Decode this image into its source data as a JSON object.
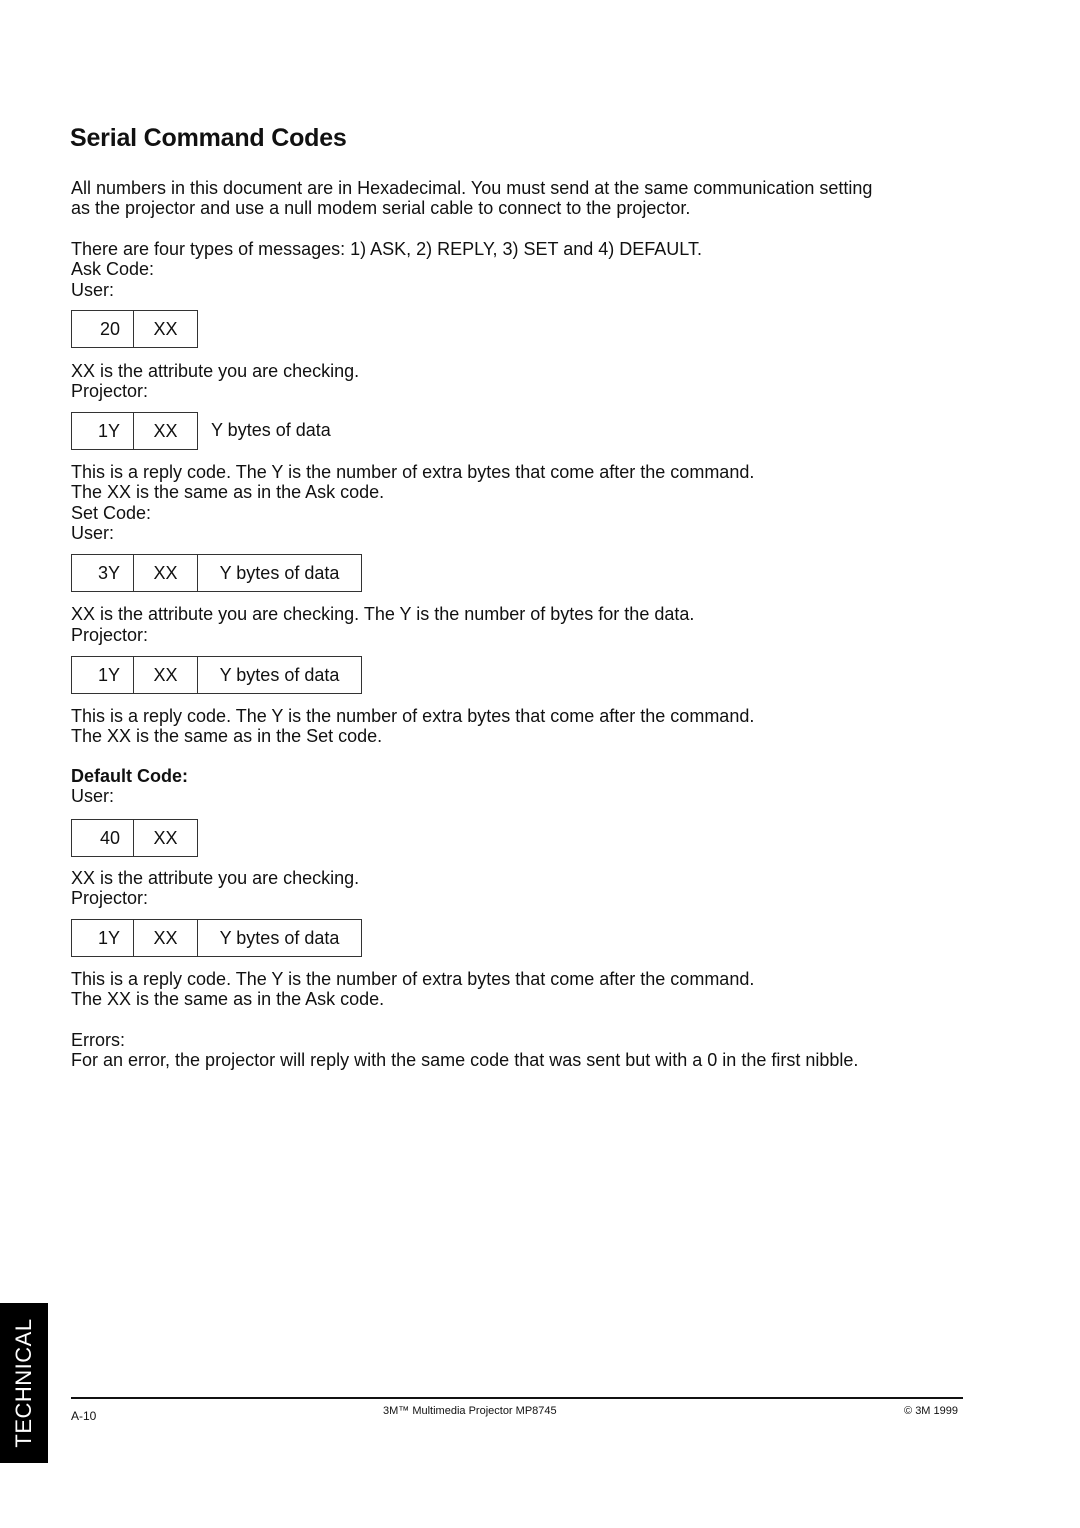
{
  "page": {
    "title": "Serial Command Codes",
    "intro": [
      "All numbers in this document are in Hexadecimal.  You must send at the same communication setting",
      "as the projector and use a null modem serial cable to connect to the projector."
    ],
    "types_line": "There are four types of messages:  1) ASK, 2) REPLY,  3) SET and 4) DEFAULT.",
    "ask": {
      "heading": "Ask Code:",
      "user_label": "User:",
      "user_code": [
        "20",
        "XX"
      ],
      "user_note": "XX is the attribute you are checking.",
      "projector_label": "Projector:",
      "projector_code": [
        "1Y",
        "XX",
        "Y bytes of data"
      ],
      "reply_note": [
        "This is a reply code. The Y is the number of extra bytes that come after the command.",
        "The XX is the same as in the Ask code."
      ]
    },
    "set": {
      "heading": "Set Code:",
      "user_label": "User:",
      "user_code": [
        "3Y",
        "XX",
        "Y bytes of data"
      ],
      "user_note": "XX is the attribute you are checking. The Y is the number of bytes for the data.",
      "projector_label": "Projector:",
      "projector_code": [
        "1Y",
        "XX",
        "Y bytes of data"
      ],
      "reply_note": [
        "This is a reply code.  The Y is the number of extra bytes that come after the command.",
        "The XX is the same as in the Set code."
      ]
    },
    "default": {
      "heading": "Default Code:",
      "user_label": "User:",
      "user_code": [
        "40",
        "XX"
      ],
      "user_note": "XX is the attribute you are checking.",
      "projector_label": "Projector:",
      "projector_code": [
        "1Y",
        "XX",
        "Y bytes of data"
      ],
      "reply_note": [
        "This is a reply code.  The Y is the number of extra bytes that come after the command.",
        "The XX is the same as in the Ask code."
      ]
    },
    "errors": {
      "heading": "Errors:",
      "text": "For an error, the projector will reply with the same code that was sent but with a 0 in the first nibble."
    }
  },
  "side_tab": {
    "label": "TECHNICAL"
  },
  "footer": {
    "page_number": "A-10",
    "product": "3M™ Multimedia Projector MP8745",
    "copyright": "© 3M 1999"
  }
}
